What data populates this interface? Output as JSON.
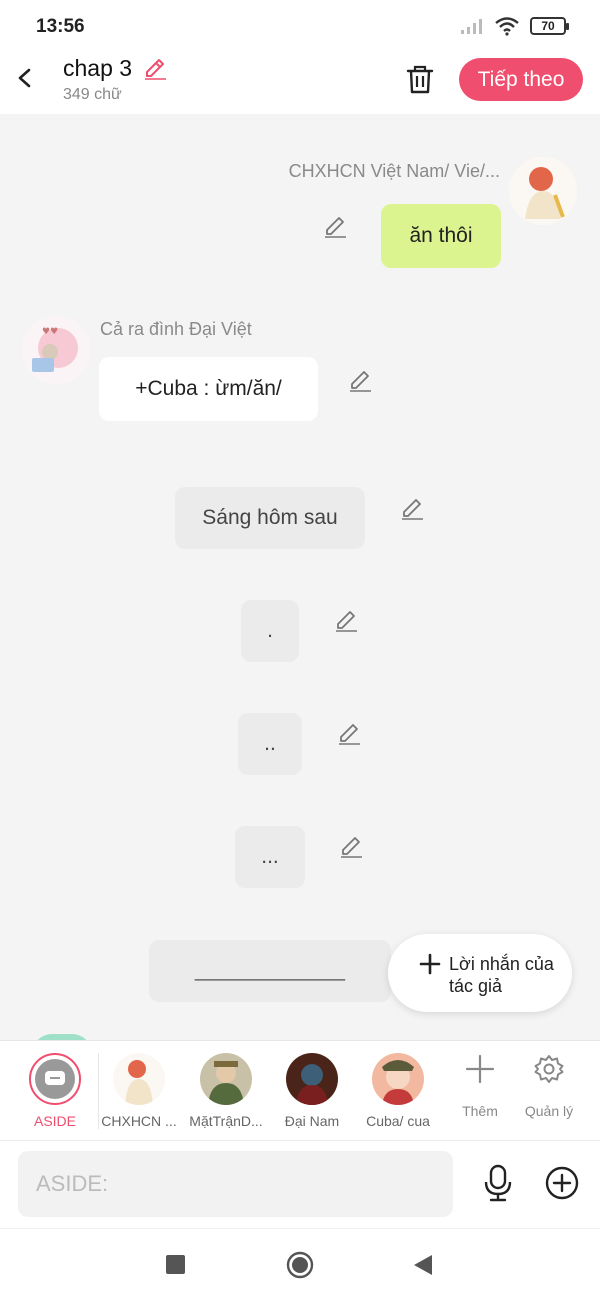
{
  "status": {
    "time": "13:56",
    "battery": "70"
  },
  "header": {
    "title": "chap 3",
    "word_count": "349 chữ",
    "next_label": "Tiếp theo"
  },
  "messages": {
    "m1": {
      "sender": "CHXHCN Việt Nam/ Vie/...",
      "text": "ăn thôi"
    },
    "m2": {
      "sender": "Cả ra đình Đại Việt",
      "text": "+Cuba : ừm/ăn/"
    },
    "n1": {
      "text": "Sáng hôm sau"
    },
    "n2": {
      "text": "."
    },
    "n3": {
      "text": ".."
    },
    "n4": {
      "text": "..."
    },
    "n5": {
      "text": "_______________"
    }
  },
  "author_note": {
    "label": "Lời nhắn của tác giả"
  },
  "char_bar": {
    "items": [
      {
        "label": "ASIDE"
      },
      {
        "label": "CHXHCN ..."
      },
      {
        "label": "MặtTrậnD..."
      },
      {
        "label": "Đại Nam"
      },
      {
        "label": "Cuba/ cua"
      }
    ],
    "add_label": "Thêm",
    "manage_label": "Quản lý"
  },
  "input": {
    "placeholder": "ASIDE:"
  },
  "colors": {
    "accent": "#f04e6e",
    "green_bubble": "#dcf48f",
    "narration": "#ebebeb",
    "background": "#f4f4f4"
  },
  "icons": [
    "back-icon",
    "pencil-icon",
    "trash-icon",
    "plus-icon",
    "gear-icon",
    "mic-icon",
    "add-circle-icon",
    "signal-icon",
    "wifi-icon"
  ]
}
